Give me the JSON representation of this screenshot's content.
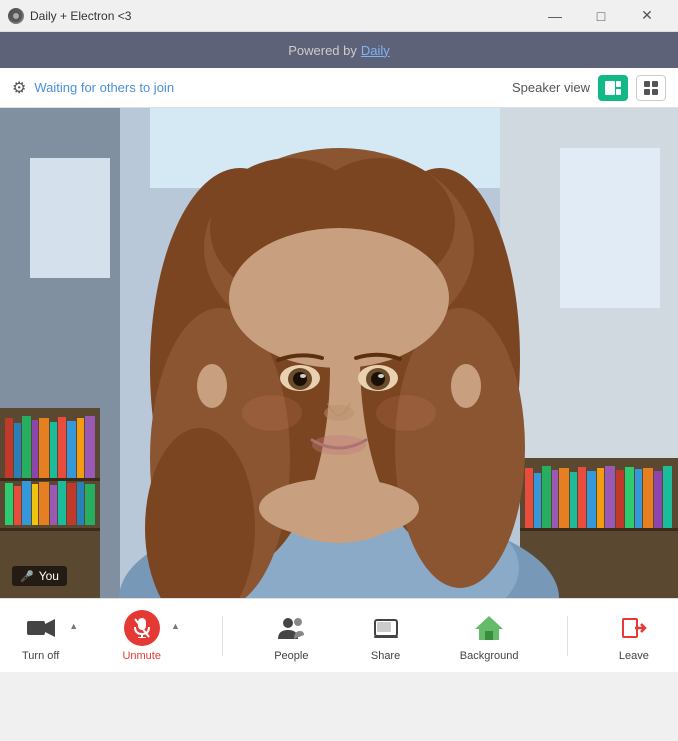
{
  "window": {
    "title": "Daily + Electron <3",
    "controls": {
      "minimize": "—",
      "maximize": "□",
      "close": "✕"
    }
  },
  "powered_bar": {
    "text": "Powered by",
    "link_text": "Daily"
  },
  "header": {
    "waiting_text_part1": "Waiting ",
    "waiting_text_part2": "for others to join",
    "speaker_view_label": "Speaker view",
    "view_active": "speaker",
    "view_btn_speaker_label": "⊞",
    "view_btn_grid_label": "⊞"
  },
  "video": {
    "name_badge": "You"
  },
  "toolbar": {
    "camera_label": "Turn off",
    "unmute_label": "Unmute",
    "people_label": "People",
    "share_label": "Share",
    "background_label": "Background",
    "leave_label": "Leave"
  },
  "colors": {
    "accent_teal": "#12b886",
    "red_btn": "#e53935",
    "header_bg": "#5e6278",
    "link_blue": "#7fb3f5"
  }
}
